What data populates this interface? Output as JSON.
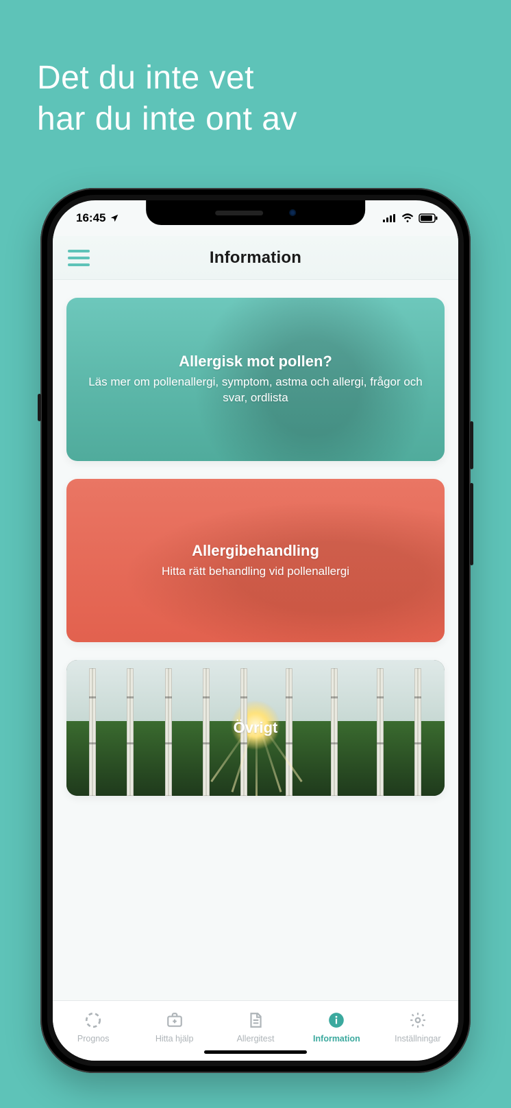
{
  "promo": {
    "line1": "Det du inte vet",
    "line2": "har du inte ont av"
  },
  "statusbar": {
    "time": "16:45"
  },
  "header": {
    "title": "Information"
  },
  "cards": [
    {
      "title": "Allergisk mot pollen?",
      "subtitle": "Läs mer om pollenallergi, symptom, astma och allergi, frågor och svar, ordlista"
    },
    {
      "title": "Allergibehandling",
      "subtitle": "Hitta rätt behandling vid pollenallergi"
    },
    {
      "title": "Övrigt",
      "subtitle": ""
    }
  ],
  "tabs": [
    {
      "label": "Prognos",
      "active": false
    },
    {
      "label": "Hitta hjälp",
      "active": false
    },
    {
      "label": "Allergitest",
      "active": false
    },
    {
      "label": "Information",
      "active": true
    },
    {
      "label": "Inställningar",
      "active": false
    }
  ]
}
